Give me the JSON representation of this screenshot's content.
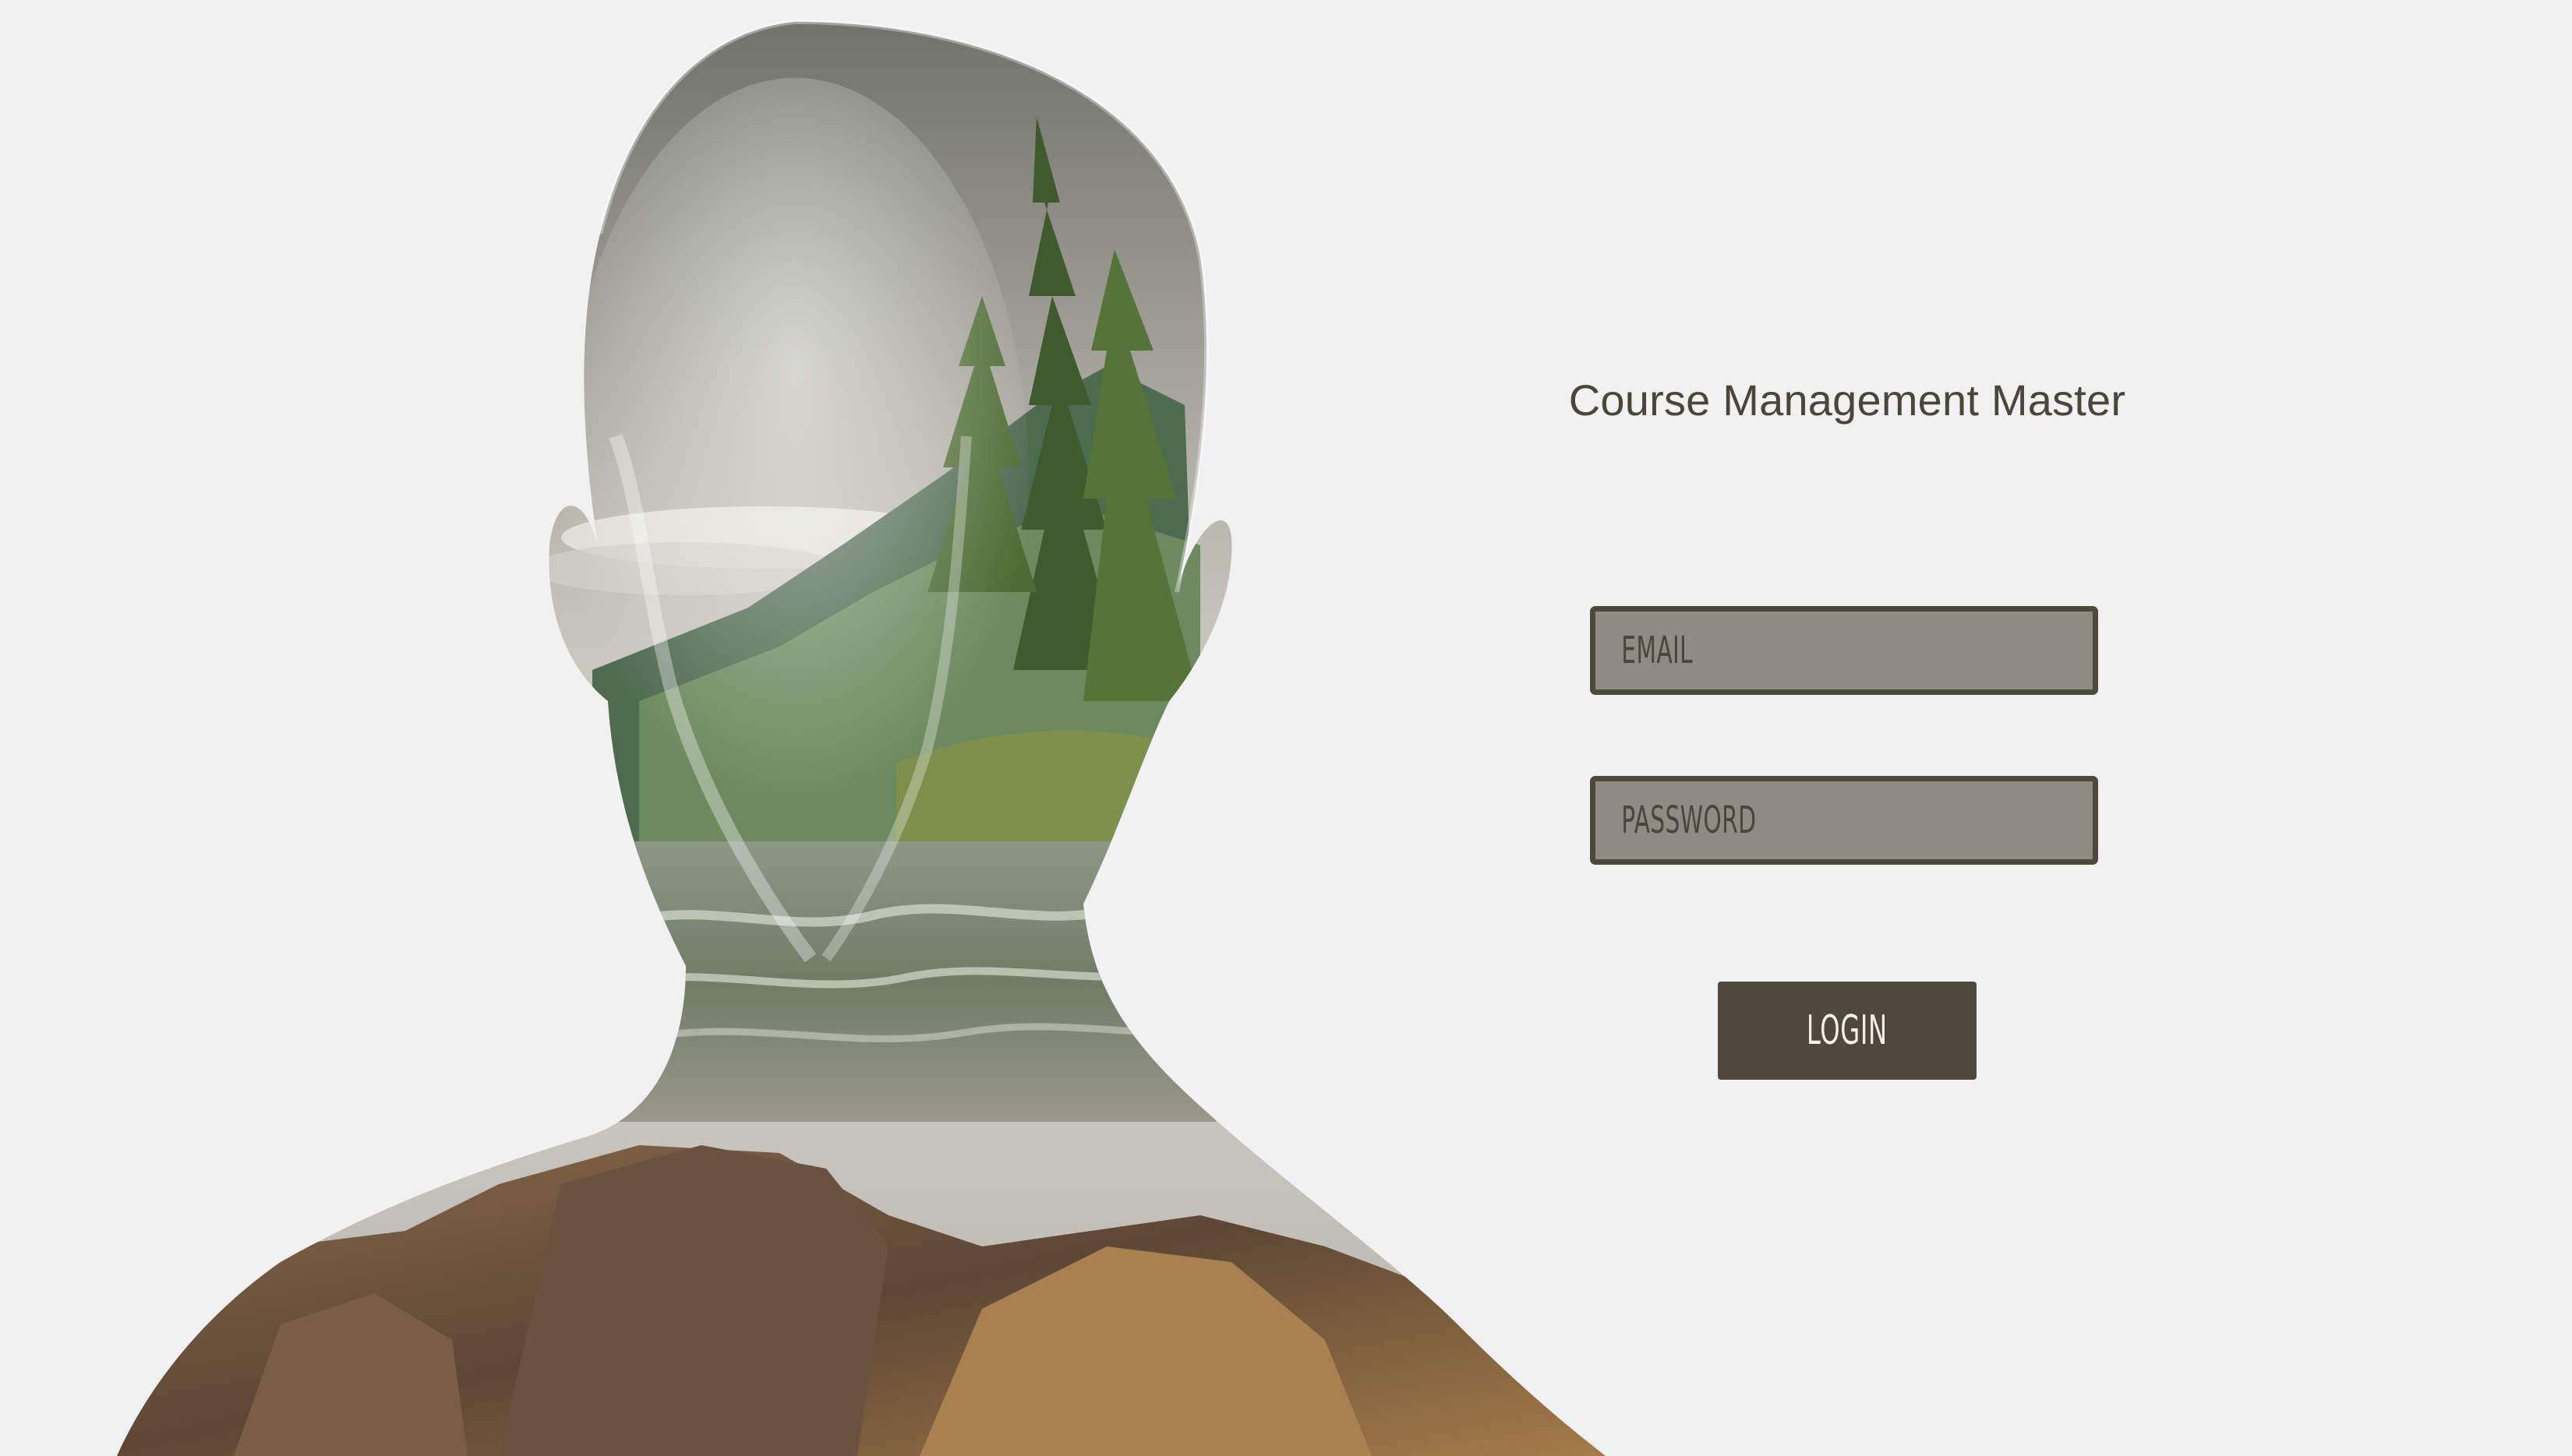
{
  "app": {
    "title": "Course Management Master"
  },
  "login_form": {
    "email_placeholder": "EMAIL",
    "email_value": "",
    "password_placeholder": "PASSWORD",
    "password_value": "",
    "login_label": "LOGIN"
  },
  "hero": {
    "image": "double-exposure-portrait",
    "scene": [
      "head-silhouette",
      "mountain-forest",
      "river",
      "rocks"
    ]
  },
  "colors": {
    "background": "#f1f1f1",
    "title_text": "#4b463b",
    "field_fill": "#8f8b83",
    "field_border": "#4f493d",
    "button_fill": "#4f493d",
    "button_text": "#f4f0e8"
  }
}
